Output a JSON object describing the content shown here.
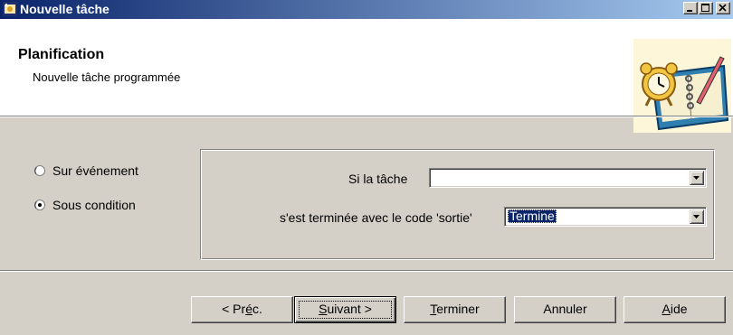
{
  "window": {
    "title": "Nouvelle tâche",
    "controls": {
      "minimize": "minimize-icon",
      "maximize": "maximize-icon",
      "close": "close-icon"
    }
  },
  "header": {
    "title": "Planification",
    "subtitle": "Nouvelle tâche programmée",
    "logo": "alarm-clock-notebook-icon"
  },
  "trigger_options": [
    {
      "label": "Sur événement",
      "checked": false
    },
    {
      "label": "Sous condition",
      "checked": true
    }
  ],
  "condition": {
    "task_label": "Si la tâche",
    "task_value": "",
    "code_label": "s'est terminée avec le code 'sortie'",
    "code_value": "Termine"
  },
  "buttons": {
    "prev": {
      "pre": "< Pr",
      "mn": "é",
      "post": "c."
    },
    "next": {
      "pre": "",
      "mn": "S",
      "post": "uivant >"
    },
    "finish": {
      "pre": "",
      "mn": "T",
      "post": "erminer"
    },
    "cancel": {
      "pre": "Annuler",
      "mn": "",
      "post": ""
    },
    "help": {
      "pre": "",
      "mn": "A",
      "post": "ide"
    }
  },
  "colors": {
    "titlebar_start": "#0a246a",
    "titlebar_end": "#a6caf0",
    "face": "#d4d0c8",
    "selection": "#0a246a"
  }
}
